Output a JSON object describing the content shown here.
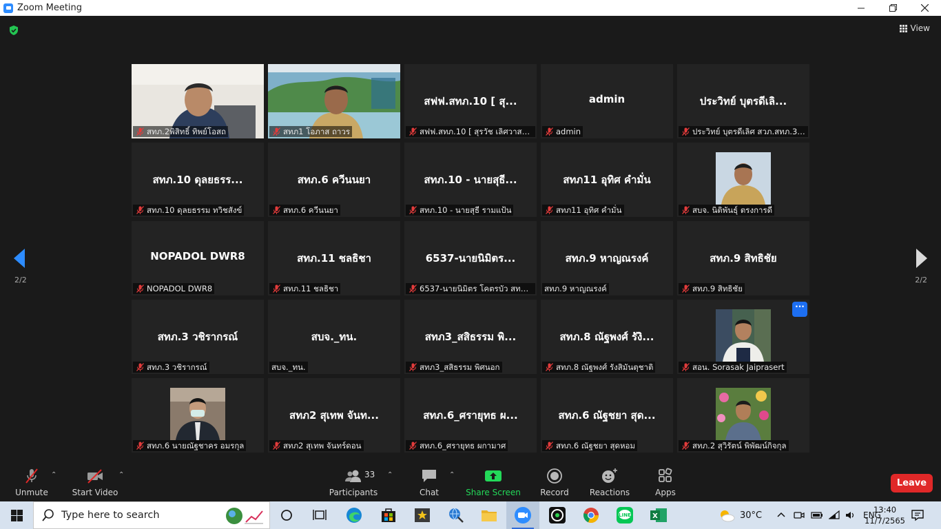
{
  "window": {
    "title": "Zoom Meeting"
  },
  "header": {
    "view_label": "View"
  },
  "pager": {
    "left": "2/2",
    "right": "2/2"
  },
  "tiles": [
    {
      "big": "",
      "label": "สทภ.2พิสิทธิ์ ทิพย์โอสถ",
      "muted": true,
      "video": "photo-office"
    },
    {
      "big": "",
      "label": "สทภ1 โอภาส ถาวร",
      "muted": true,
      "video": "photo-poster"
    },
    {
      "big": "สฟฟ.สทภ.10 [ สุ...",
      "label": "สฟฟ.สทภ.10 [ สุรวัช เลิศวาสน...",
      "muted": true
    },
    {
      "big": "admin",
      "label": "admin",
      "muted": true
    },
    {
      "big": "ประวิทย์ บุตรดีเลิ...",
      "label": "ประวิทย์ บุตรดีเลิศ สวภ.สทภ.3 ห...",
      "muted": true
    },
    {
      "big": "สทภ.10 ดุลยธรร...",
      "label": "สทภ.10 ดุลยธรรม ทวิชสังข์",
      "muted": true
    },
    {
      "big": "สทภ.6 ควีนนยา",
      "label": "สทภ.6 ควีนนยา",
      "muted": true
    },
    {
      "big": "สทภ.10 - นายสุธี...",
      "label": "สทภ.10 - นายสุธี รามแป้น",
      "muted": true
    },
    {
      "big": "สทภ11 อุทิศ คำมั่น",
      "label": "สทภ11 อุทิศ คำมั่น",
      "muted": true
    },
    {
      "big": "",
      "label": "สบจ. นิติพันธุ์ ตรงการดี",
      "muted": true,
      "video": "thumb-uniform"
    },
    {
      "big": "NOPADOL DWR8",
      "label": "NOPADOL DWR8",
      "muted": true
    },
    {
      "big": "สทภ.11 ชลธิชา",
      "label": "สทภ.11 ชลธิชา",
      "muted": true
    },
    {
      "big": "6537-นายนิมิตร...",
      "label": "6537-นายนิมิตร โคตรบัว สทภ.9",
      "muted": true
    },
    {
      "big": "สทภ.9 หาญณรงค์",
      "label": "สทภ.9 หาญณรงค์",
      "muted": false
    },
    {
      "big": "สทภ.9 สิทธิชัย",
      "label": "สทภ.9 สิทธิชัย",
      "muted": true
    },
    {
      "big": "สทภ.3 วชิรากรณ์",
      "label": "สทภ.3 วชิรากรณ์",
      "muted": true
    },
    {
      "big": "สบจ._ทน.",
      "label": "สบจ._ทน.",
      "muted": false
    },
    {
      "big": "สทภ3_สสิธรรม พิ...",
      "label": "สทภ3_สสิธรรม พิศนอก",
      "muted": true
    },
    {
      "big": "สทภ.8 ณัฐพงศ์ รังิ...",
      "label": "สทภ.8 ณัฐพงศ์ รังสิมันตุชาติ",
      "muted": true
    },
    {
      "big": "",
      "label": "สอน. Sorasak Jaiprasert",
      "muted": true,
      "video": "thumb-uniform2"
    },
    {
      "big": "",
      "label": "สทภ.6 นายณัฐชาคร อมรกุล",
      "muted": true,
      "video": "thumb-mask"
    },
    {
      "big": "สทภ2 สุเทพ จันท...",
      "label": "สทภ2 สุเทพ จันทร์ดอน",
      "muted": true
    },
    {
      "big": "สทภ.6_ศรายุทธ ผ...",
      "label": "สทภ.6_ศรายุทธ ผกามาศ",
      "muted": true
    },
    {
      "big": "สทภ.6 ณัฐชยา สุด...",
      "label": "สทภ.6 ณัฐชยา สุดหอม",
      "muted": true
    },
    {
      "big": "",
      "label": "สทภ.2 สุวิรัตน์ พิพัฒน์กิจกุล",
      "muted": true,
      "video": "thumb-flowers"
    }
  ],
  "more_label": "···",
  "toolbar": {
    "unmute": "Unmute",
    "start_video": "Start Video",
    "participants": "Participants",
    "participants_count": "33",
    "chat": "Chat",
    "share": "Share Screen",
    "record": "Record",
    "reactions": "Reactions",
    "apps": "Apps",
    "leave": "Leave",
    "share_color": "#23d959",
    "leave_color": "#e02828"
  },
  "taskbar": {
    "search_placeholder": "Type here to search",
    "weather": "30°C",
    "lang": "ENG",
    "time": "13:40",
    "date": "11/7/2565"
  }
}
